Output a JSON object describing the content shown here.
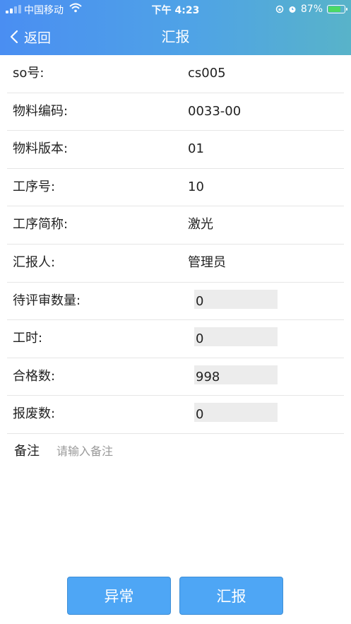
{
  "status_bar": {
    "carrier": "中国移动",
    "time": "下午 4:23",
    "battery": "87%",
    "battery_level": 0.87
  },
  "nav": {
    "back_label": "返回",
    "title": "汇报"
  },
  "form": {
    "rows": [
      {
        "label": "so号:",
        "value": "cs005"
      },
      {
        "label": "物料编码:",
        "value": "0033-00"
      },
      {
        "label": "物料版本:",
        "value": "01"
      },
      {
        "label": "工序号:",
        "value": "10"
      },
      {
        "label": "工序简称:",
        "value": "激光"
      },
      {
        "label": "汇报人:",
        "value": "管理员"
      }
    ],
    "inputs": [
      {
        "label": "待评审数量:",
        "value": "0"
      },
      {
        "label": "工时:",
        "value": "0"
      },
      {
        "label": "合格数:",
        "value": "998"
      },
      {
        "label": "报废数:",
        "value": "0"
      }
    ],
    "remark": {
      "label": "备注",
      "placeholder": "请输入备注",
      "value": ""
    }
  },
  "buttons": {
    "exception": "异常",
    "report": "汇报"
  },
  "colors": {
    "header_start": "#4a8ef2",
    "header_end": "#58b3c9",
    "button": "#4ea6f5"
  }
}
